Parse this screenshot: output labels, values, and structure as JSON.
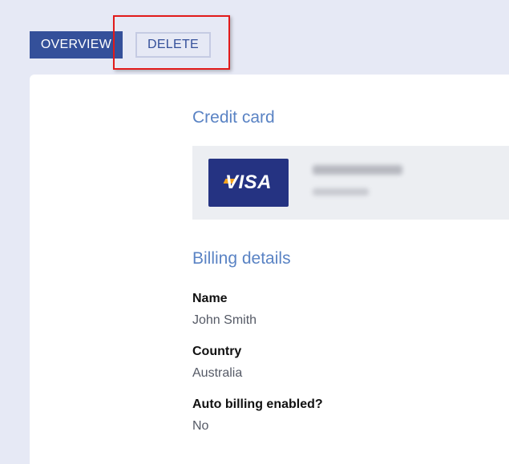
{
  "tabs": {
    "overview_label": "OVERVIEW",
    "delete_label": "DELETE"
  },
  "credit_card": {
    "title": "Credit card",
    "brand": "VISA",
    "brand_color": "#253382"
  },
  "billing": {
    "title": "Billing details",
    "fields": [
      {
        "label": "Name",
        "value": "John Smith"
      },
      {
        "label": "Country",
        "value": "Australia"
      },
      {
        "label": "Auto billing enabled?",
        "value": "No"
      }
    ]
  },
  "colors": {
    "accent": "#34509a",
    "section_title": "#5a83c4",
    "highlight": "#e21a1a",
    "background": "#e6e9f5"
  }
}
